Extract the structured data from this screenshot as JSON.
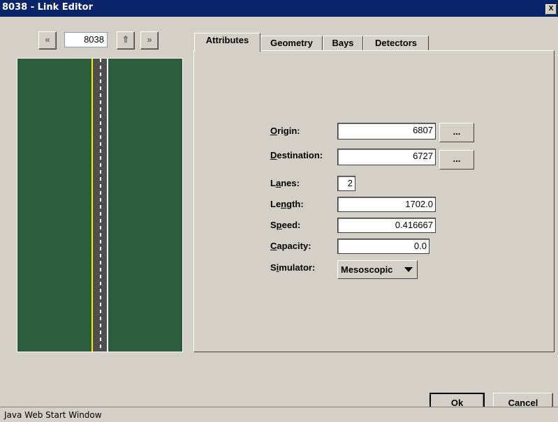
{
  "window": {
    "title": "8038 - Link Editor",
    "close_label": "X"
  },
  "nav": {
    "prev_icon": "«",
    "link_id": "8038",
    "up_icon": "⇑",
    "next_icon": "»"
  },
  "tabs": [
    {
      "label": "Attributes",
      "active": true
    },
    {
      "label": "Geometry",
      "active": false
    },
    {
      "label": "Bays",
      "active": false
    },
    {
      "label": "Detectors",
      "active": false
    }
  ],
  "form": {
    "origin": {
      "label_mnemonic": "O",
      "label_rest": "rigin:",
      "value": "6807",
      "browse": "..."
    },
    "destination": {
      "label_mnemonic": "D",
      "label_rest": "estination:",
      "value": "6727",
      "browse": "..."
    },
    "lanes": {
      "label_pre": "L",
      "label_mnemonic": "a",
      "label_rest": "nes:",
      "value": "2"
    },
    "length": {
      "label_pre": "Le",
      "label_mnemonic": "n",
      "label_rest": "gth:",
      "value": "1702.0"
    },
    "speed": {
      "label_pre": "S",
      "label_mnemonic": "p",
      "label_rest": "eed:",
      "value": "0.416667"
    },
    "capacity": {
      "label_mnemonic": "C",
      "label_rest": "apacity:",
      "value": "0.0"
    },
    "simulator": {
      "label_pre": "S",
      "label_mnemonic": "i",
      "label_rest": "mulator:",
      "value": "Mesoscopic"
    }
  },
  "buttons": {
    "ok": "Ok",
    "cancel": "Cancel"
  },
  "status": {
    "text": "Java Web Start Window"
  },
  "colors": {
    "titlebar": "#0a246a",
    "road_grass": "#2c5e3e",
    "center_line": "#ffee00",
    "chrome": "#d4d0c8"
  }
}
